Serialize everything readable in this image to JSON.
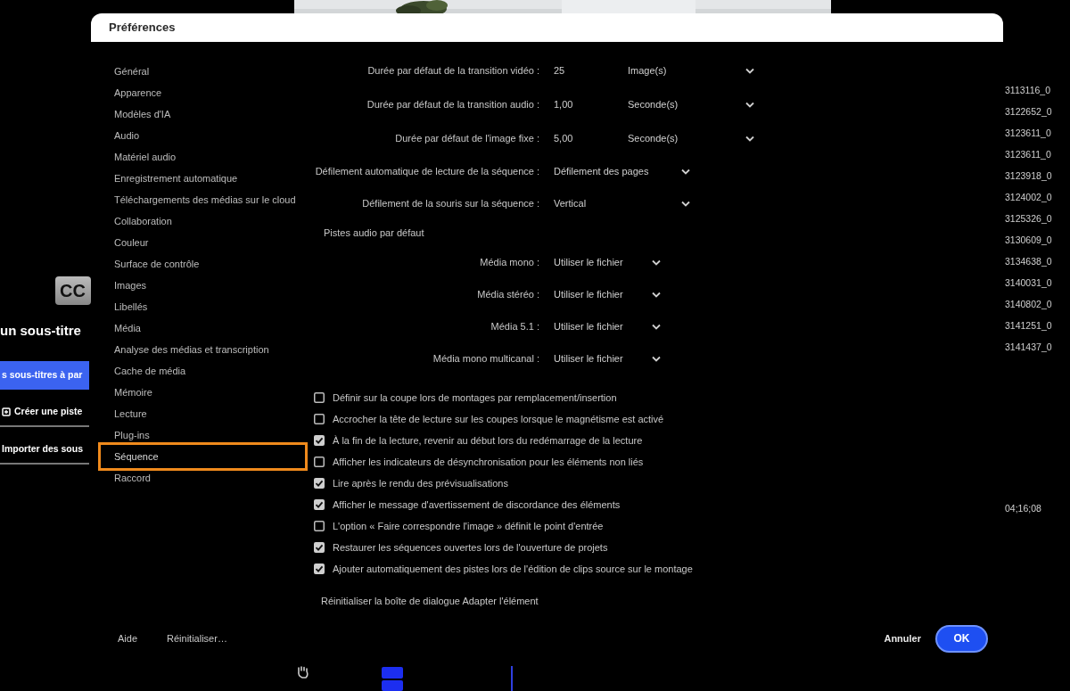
{
  "background": {
    "left_panel": {
      "icon_label": "CC",
      "title": "un sous-titre",
      "buttons": [
        {
          "label": "s sous-titres à par",
          "kind": "primary"
        },
        {
          "label": "Créer une piste",
          "kind": "icon"
        },
        {
          "label": "Importer des sous",
          "kind": "plain"
        }
      ]
    },
    "clip_list": [
      "3113116_0",
      "3122652_0",
      "3123611_0",
      "3123611_0",
      "3123918_0",
      "3124002_0",
      "3125326_0",
      "3130609_0",
      "3134638_0",
      "3140031_0",
      "3140802_0",
      "3141251_0",
      "3141437_0"
    ],
    "timecode": "04;16;08"
  },
  "dialog": {
    "title": "Préférences",
    "sidebar": [
      {
        "label": "Général",
        "selected": false
      },
      {
        "label": "Apparence",
        "selected": false
      },
      {
        "label": "Modèles d'IA",
        "selected": false
      },
      {
        "label": "Audio",
        "selected": false
      },
      {
        "label": "Matériel audio",
        "selected": false
      },
      {
        "label": "Enregistrement automatique",
        "selected": false
      },
      {
        "label": "Téléchargements des médias sur le cloud",
        "selected": false
      },
      {
        "label": "Collaboration",
        "selected": false
      },
      {
        "label": "Couleur",
        "selected": false
      },
      {
        "label": "Surface de contrôle",
        "selected": false
      },
      {
        "label": "Images",
        "selected": false
      },
      {
        "label": "Libellés",
        "selected": false
      },
      {
        "label": "Média",
        "selected": false
      },
      {
        "label": "Analyse des médias et transcription",
        "selected": false
      },
      {
        "label": "Cache de média",
        "selected": false
      },
      {
        "label": "Mémoire",
        "selected": false
      },
      {
        "label": "Lecture",
        "selected": false
      },
      {
        "label": "Plug-ins",
        "selected": false
      },
      {
        "label": "Séquence",
        "selected": true
      },
      {
        "label": "Raccord",
        "selected": false
      }
    ],
    "duration_fields": [
      {
        "label": "Durée par défaut de la transition vidéo :",
        "value": "25",
        "unit": "Image(s)"
      },
      {
        "label": "Durée par défaut de la transition audio :",
        "value": "1,00",
        "unit": "Seconde(s)"
      },
      {
        "label": "Durée par défaut de l'image fixe :",
        "value": "5,00",
        "unit": "Seconde(s)"
      }
    ],
    "dropdowns": [
      {
        "label": "Défilement automatique de lecture de la séquence :",
        "value": "Défilement des pages"
      },
      {
        "label": "Défilement de la souris sur la séquence :",
        "value": "Vertical"
      }
    ],
    "audio_section": {
      "title": "Pistes audio par défaut",
      "dropdowns": [
        {
          "label": "Média mono :",
          "value": "Utiliser le fichier"
        },
        {
          "label": "Média stéréo :",
          "value": "Utiliser le fichier"
        },
        {
          "label": "Média 5.1 :",
          "value": "Utiliser le fichier"
        },
        {
          "label": "Média mono multicanal :",
          "value": "Utiliser le fichier"
        }
      ]
    },
    "checkboxes": [
      {
        "label": "Définir sur la coupe lors de montages par remplacement/insertion",
        "checked": false
      },
      {
        "label": "Accrocher la tête de lecture sur les coupes lorsque le magnétisme est activé",
        "checked": false
      },
      {
        "label": "À la fin de la lecture, revenir au début lors du redémarrage de la lecture",
        "checked": true
      },
      {
        "label": "Afficher les indicateurs de désynchronisation pour les éléments non liés",
        "checked": false
      },
      {
        "label": "Lire après le rendu des prévisualisations",
        "checked": true
      },
      {
        "label": "Afficher le message d'avertissement de discordance des éléments",
        "checked": true
      },
      {
        "label": "L'option « Faire correspondre l'image » définit le point d'entrée",
        "checked": false
      },
      {
        "label": "Restaurer les séquences ouvertes lors de l'ouverture de projets",
        "checked": true
      },
      {
        "label": "Ajouter automatiquement des pistes lors de l'édition de clips source sur le montage",
        "checked": true
      }
    ],
    "reset_button": "Réinitialiser la boîte de dialogue Adapter l'élément",
    "footer": {
      "left_buttons": [
        "Aide",
        "Réinitialiser…"
      ],
      "cancel": "Annuler",
      "ok": "OK"
    }
  }
}
